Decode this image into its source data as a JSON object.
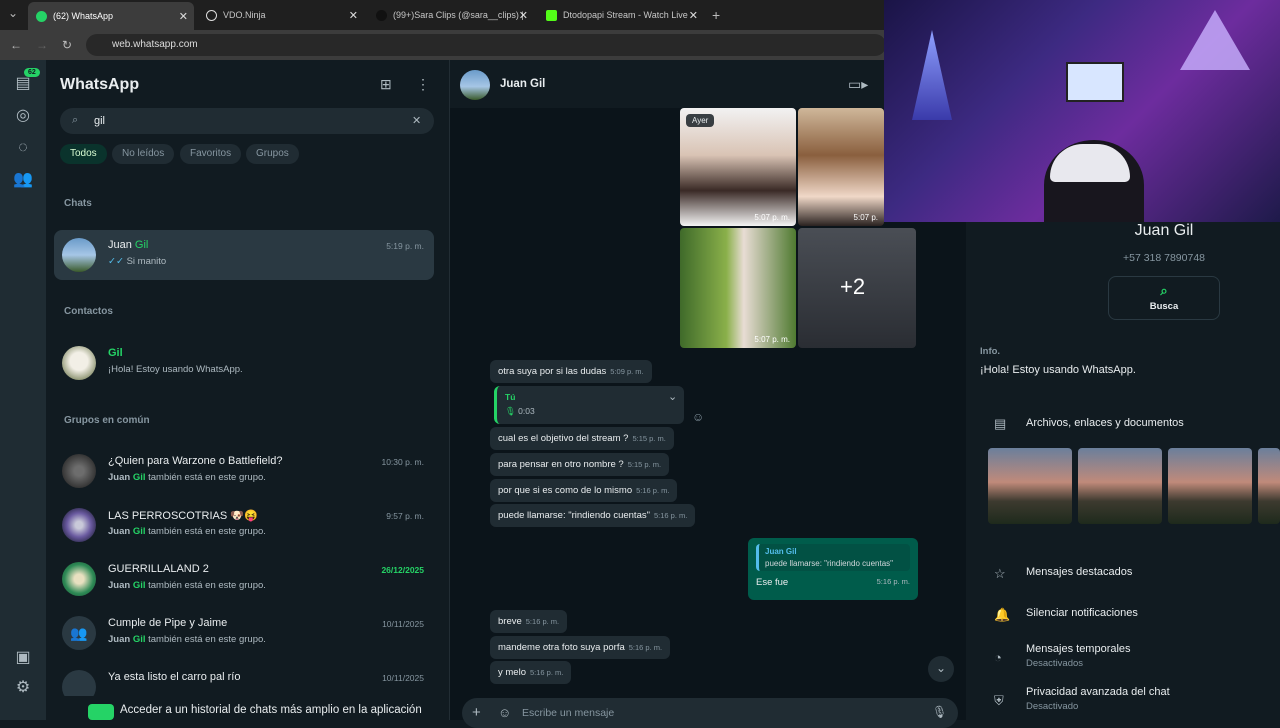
{
  "browser": {
    "tabs": [
      {
        "label": "(62) WhatsApp",
        "fav": "#25d366"
      },
      {
        "label": "VDO.Ninja",
        "fav": "#e9edef"
      },
      {
        "label": "(99+)Sara Clips (@sara__clips) |",
        "fav": "#ffffff"
      },
      {
        "label": "Dtodopapi Stream - Watch Live",
        "fav": "#53fc18"
      }
    ],
    "url": "web.whatsapp.com"
  },
  "rail": {
    "badge": "62"
  },
  "left": {
    "title": "WhatsApp",
    "search_value": "gil",
    "filters": [
      "Todos",
      "No leídos",
      "Favoritos",
      "Grupos"
    ],
    "section_chats": "Chats",
    "section_contacts": "Contactos",
    "section_groups": "Grupos en común",
    "chat": {
      "name_a": "Juan ",
      "name_b": "Gil",
      "sub": "Si manito",
      "time": "5:19 p. m."
    },
    "contact": {
      "name": "Gil",
      "sub": "¡Hola! Estoy usando WhatsApp."
    },
    "groups": [
      {
        "name": "¿Quien para Warzone o Battlefield?",
        "sub_a": "Juan ",
        "sub_b": "Gil",
        "sub_c": " también está en este grupo.",
        "time": "10:30 p. m.",
        "time_green": false
      },
      {
        "name": "LAS PERROSCOTRIAS 🐶😝",
        "sub_a": "Juan ",
        "sub_b": "Gil",
        "sub_c": " también está en este grupo.",
        "time": "9:57 p. m.",
        "time_green": false
      },
      {
        "name": "GUERRILLALAND 2",
        "sub_a": "Juan ",
        "sub_b": "Gil",
        "sub_c": " también está en este grupo.",
        "time": "26/12/2025",
        "time_green": true
      },
      {
        "name": "Cumple de Pipe y Jaime",
        "sub_a": "Juan ",
        "sub_b": "Gil",
        "sub_c": " también está en este grupo.",
        "time": "10/11/2025",
        "time_green": false
      },
      {
        "name": "Ya esta listo el carro pal río",
        "sub_a": "",
        "sub_b": "",
        "sub_c": "",
        "time": "10/11/2025",
        "time_green": false
      }
    ],
    "banner": "Acceder a un historial de chats más amplio en la aplicación"
  },
  "chat": {
    "contact": "Juan Gil",
    "day_label": "Ayer",
    "photo_times": [
      "5:07 p. m.",
      "5:07 p.",
      "5:07 p. m."
    ],
    "more_count": "+2",
    "messages_in": [
      {
        "text": "otra suya por si las dudas",
        "time": "5:09 p. m."
      },
      {
        "text": "cual es el objetivo del stream ?",
        "time": "5:15 p. m."
      },
      {
        "text": "para pensar en otro nombre ?",
        "time": "5:15 p. m."
      },
      {
        "text": "por que si es como de lo mismo",
        "time": "5:16 p. m."
      },
      {
        "text": "puede llamarse: \"rindiendo cuentas\"",
        "time": "5:16 p. m."
      },
      {
        "text": "breve",
        "time": "5:16 p. m."
      },
      {
        "text": "mandeme otra foto suya porfa",
        "time": "5:16 p. m."
      },
      {
        "text": "y melo",
        "time": "5:16 p. m."
      }
    ],
    "voice": {
      "who": "Tú",
      "duration": "0:03"
    },
    "reply": {
      "quoted_name": "Juan Gil",
      "quoted_text": "puede llamarse: \"rindiendo cuentas\"",
      "text": "Ese fue",
      "time": "5:16 p. m."
    },
    "composer_placeholder": "Escribe un mensaje"
  },
  "info": {
    "name": "Juan Gil",
    "phone": "+57 318 7890748",
    "search_label": "Busca",
    "info_label": "Info.",
    "about": "¡Hola! Estoy usando WhatsApp.",
    "files_label": "Archivos, enlaces y documentos",
    "starred": "Mensajes destacados",
    "mute": "Silenciar notificaciones",
    "temp": "Mensajes temporales",
    "temp_sub": "Desactivados",
    "privacy": "Privacidad avanzada del chat",
    "privacy_sub": "Desactivado"
  }
}
